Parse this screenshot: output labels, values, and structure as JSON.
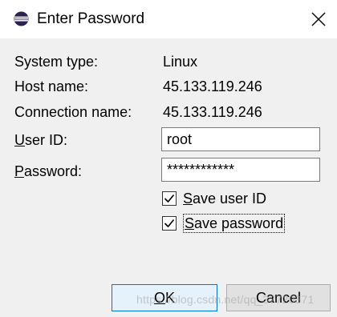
{
  "window": {
    "title": "Enter Password",
    "app_icon": "eclipse-icon",
    "close_icon": "close-icon"
  },
  "info": {
    "system_type_label": "System type:",
    "system_type_value": "Linux",
    "host_name_label": "Host name:",
    "host_name_value": "45.133.119.246",
    "connection_name_label": "Connection name:",
    "connection_name_value": "45.133.119.246"
  },
  "form": {
    "user_id_mnemonic": "U",
    "user_id_label_rest": "ser ID:",
    "user_id_value": "root",
    "password_mnemonic": "P",
    "password_label_rest": "assword:",
    "password_value": "************"
  },
  "options": {
    "save_user_id_mnemonic": "S",
    "save_user_id_rest": "ave user ID",
    "save_user_id_checked": true,
    "save_password_mnemonic": "S",
    "save_password_rest": "ave password",
    "save_password_checked": true
  },
  "buttons": {
    "ok_mnemonic": "O",
    "ok_rest": "K",
    "cancel_label": "Cancel"
  },
  "watermark": "https://blog.csdn.net/qq_37720371",
  "colors": {
    "window_bg": "#f0f0f0",
    "titlebar_bg": "#ffffff",
    "ok_border": "#0078d7",
    "ok_bg": "#e5f1fb"
  }
}
